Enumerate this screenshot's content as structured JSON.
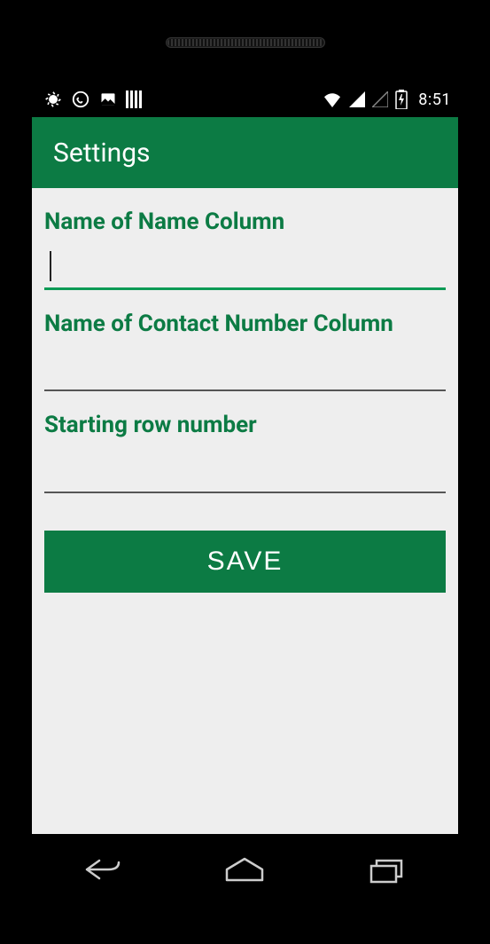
{
  "status": {
    "time": "8:51"
  },
  "header": {
    "title": "Settings"
  },
  "form": {
    "field1_label": "Name of Name Column",
    "field1_value": "",
    "field2_label": "Name of Contact Number Column",
    "field2_value": "",
    "field3_label": "Starting row number",
    "field3_value": "",
    "save_label": "SAVE"
  }
}
